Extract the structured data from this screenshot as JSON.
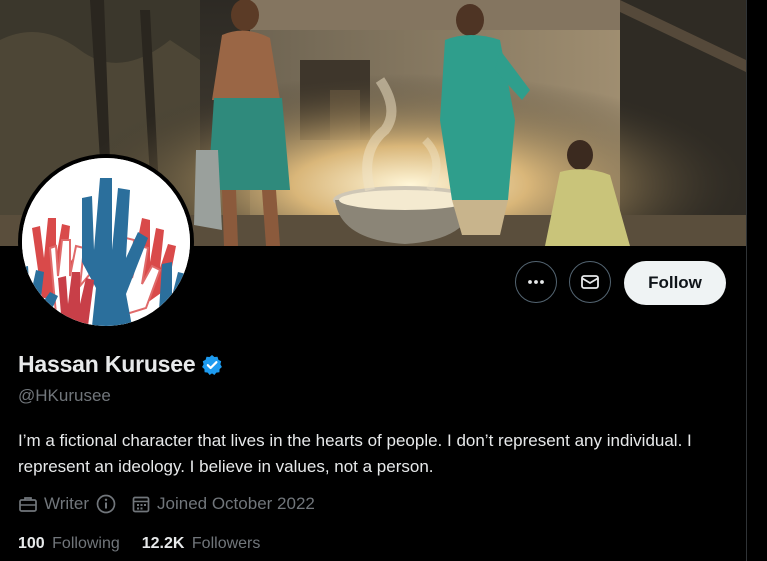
{
  "profile": {
    "display_name": "Hassan Kurusee",
    "handle": "@HKurusee",
    "verified": true,
    "bio": "I’m a fictional character that lives in the hearts of people. I don’t represent any individual. I represent an ideology. I believe in values, not a person.",
    "profession": "Writer",
    "joined": "Joined October 2022"
  },
  "actions": {
    "more_icon": "more-horizontal-icon",
    "message_icon": "envelope-icon",
    "follow_label": "Follow"
  },
  "stats": {
    "following_count": "100",
    "following_label": "Following",
    "followers_count": "12.2K",
    "followers_label": "Followers"
  },
  "colors": {
    "background": "#000000",
    "text_primary": "#e7e9ea",
    "text_secondary": "#71767b",
    "verified_blue": "#1d9bf0",
    "follow_button_bg": "#eff3f4",
    "border": "#536471"
  }
}
